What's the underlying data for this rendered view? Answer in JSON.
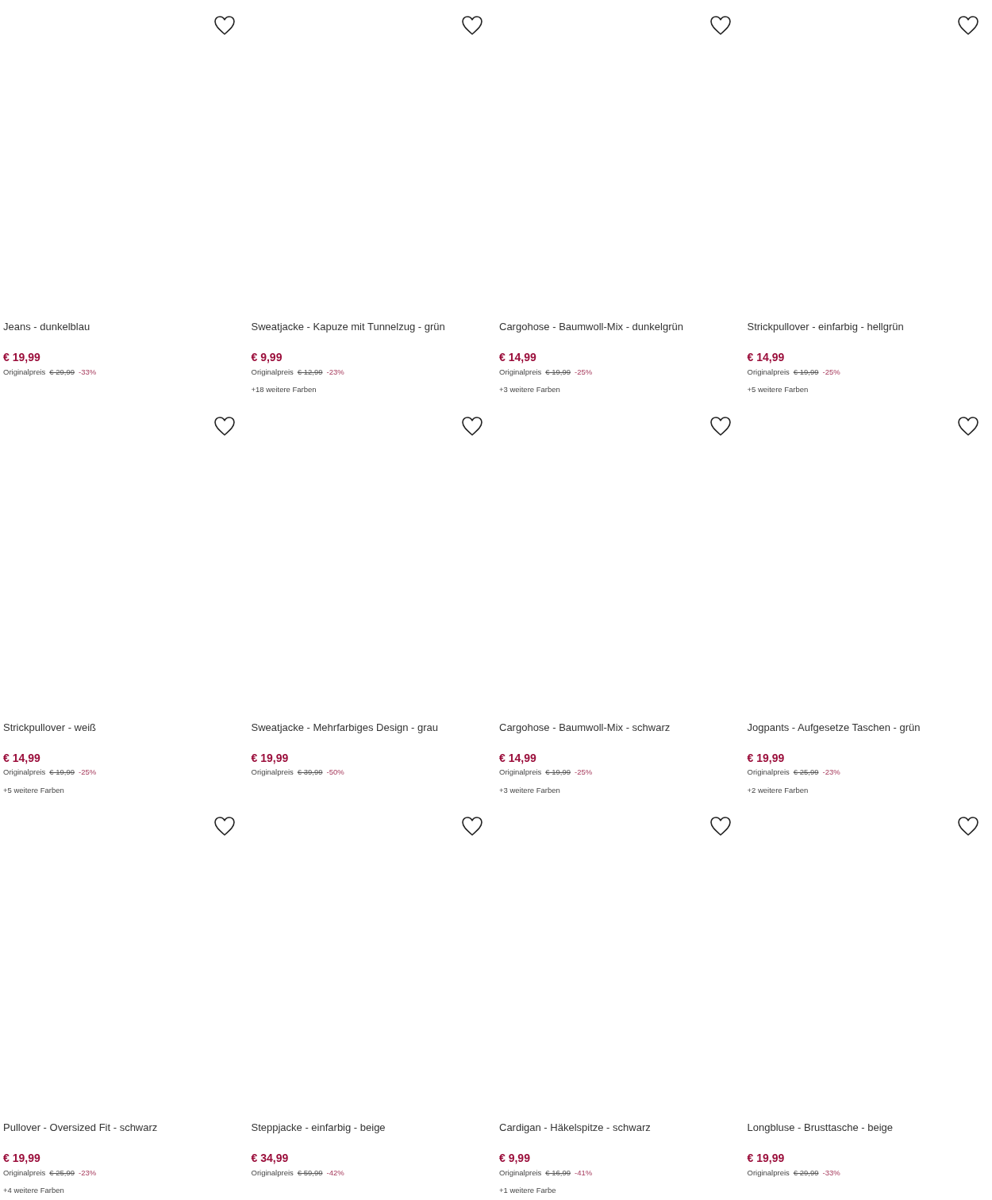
{
  "products": [
    {
      "name": "Jeans - dunkelblau",
      "price": "€ 19,99",
      "original_label": "Originalpreis",
      "original_price": "€ 29,99",
      "discount": "-33%"
    },
    {
      "name": "Sweatjacke - Kapuze mit Tunnelzug - grün",
      "price": "€ 9,99",
      "original_label": "Originalpreis",
      "original_price": "€ 12,99",
      "discount": "-23%",
      "colors": "+18 weitere Farben"
    },
    {
      "name": "Cargohose - Baumwoll-Mix - dunkelgrün",
      "price": "€ 14,99",
      "original_label": "Originalpreis",
      "original_price": "€ 19,99",
      "discount": "-25%",
      "colors": "+3 weitere Farben"
    },
    {
      "name": "Strickpullover - einfarbig - hellgrün",
      "price": "€ 14,99",
      "original_label": "Originalpreis",
      "original_price": "€ 19,99",
      "discount": "-25%",
      "colors": "+5 weitere Farben"
    },
    {
      "name": "Strickpullover - weiß",
      "price": "€ 14,99",
      "original_label": "Originalpreis",
      "original_price": "€ 19,99",
      "discount": "-25%",
      "colors": "+5 weitere Farben"
    },
    {
      "name": "Sweatjacke - Mehrfarbiges Design - grau",
      "price": "€ 19,99",
      "original_label": "Originalpreis",
      "original_price": "€ 39,99",
      "discount": "-50%"
    },
    {
      "name": "Cargohose - Baumwoll-Mix - schwarz",
      "price": "€ 14,99",
      "original_label": "Originalpreis",
      "original_price": "€ 19,99",
      "discount": "-25%",
      "colors": "+3 weitere Farben"
    },
    {
      "name": "Jogpants - Aufgesetze Taschen - grün",
      "price": "€ 19,99",
      "original_label": "Originalpreis",
      "original_price": "€ 25,99",
      "discount": "-23%",
      "colors": "+2 weitere Farben"
    },
    {
      "name": "Pullover - Oversized Fit - schwarz",
      "price": "€ 19,99",
      "original_label": "Originalpreis",
      "original_price": "€ 25,99",
      "discount": "-23%",
      "colors": "+4 weitere Farben"
    },
    {
      "name": "Steppjacke - einfarbig - beige",
      "price": "€ 34,99",
      "original_label": "Originalpreis",
      "original_price": "€ 59,99",
      "discount": "-42%"
    },
    {
      "name": "Cardigan - Häkelspitze - schwarz",
      "price": "€ 9,99",
      "original_label": "Originalpreis",
      "original_price": "€ 16,99",
      "discount": "-41%",
      "colors": "+1 weitere Farbe"
    },
    {
      "name": "Longbluse - Brusttasche - beige",
      "price": "€ 19,99",
      "original_label": "Originalpreis",
      "original_price": "€ 29,99",
      "discount": "-33%"
    }
  ]
}
